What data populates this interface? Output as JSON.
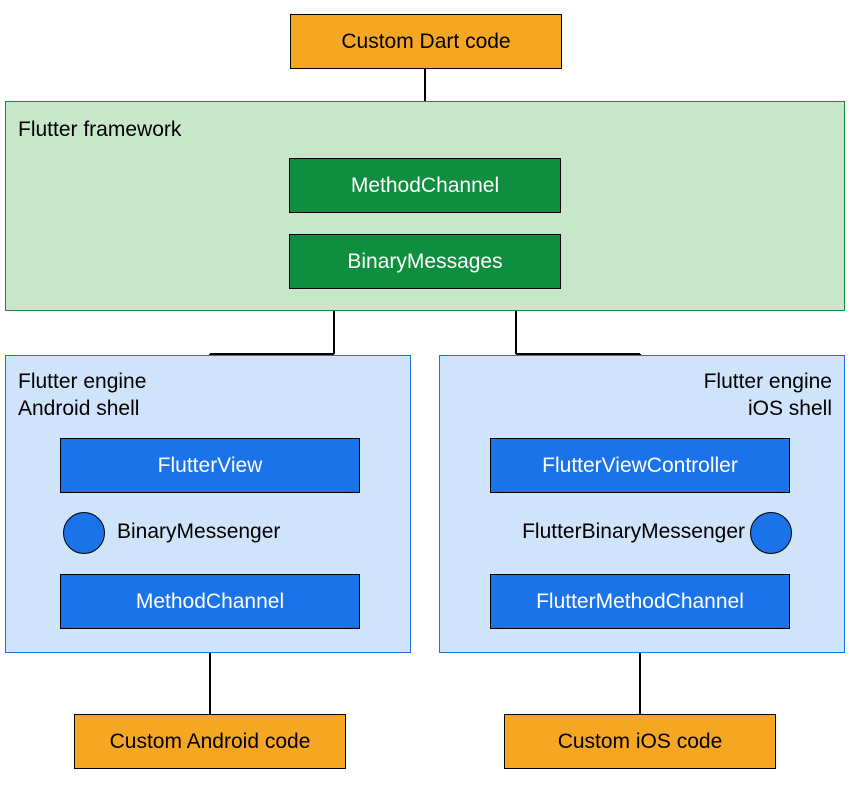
{
  "top": {
    "custom_dart": "Custom Dart code"
  },
  "framework": {
    "title": "Flutter framework",
    "method_channel": "MethodChannel",
    "binary_messages": "BinaryMessages"
  },
  "android": {
    "title_line1": "Flutter engine",
    "title_line2": "Android shell",
    "flutter_view": "FlutterView",
    "binary_messenger": "BinaryMessenger",
    "method_channel": "MethodChannel",
    "custom_code": "Custom Android code"
  },
  "ios": {
    "title_line1": "Flutter engine",
    "title_line2": "iOS shell",
    "flutter_view_controller": "FlutterViewController",
    "binary_messenger": "FlutterBinaryMessenger",
    "method_channel": "FlutterMethodChannel",
    "custom_code": "Custom iOS code"
  }
}
